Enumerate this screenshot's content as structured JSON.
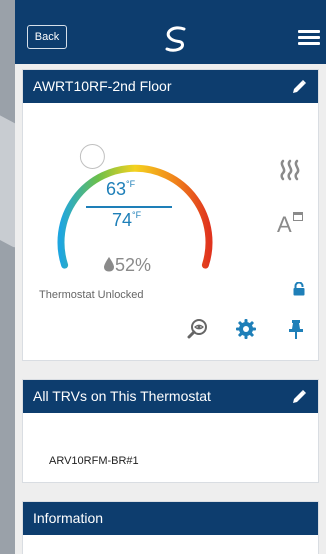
{
  "header": {
    "back_label": "Back"
  },
  "thermostat_card": {
    "title": "AWRT10RF-2nd Floor",
    "setpoint": "63",
    "setpoint_unit": "°F",
    "room_temp": "74",
    "room_unit": "°F",
    "humidity": "52%",
    "status": "Thermostat Unlocked",
    "icons": [
      "pencil-icon",
      "heat-waves-icon",
      "auto-schedule-icon",
      "lock-icon",
      "magnifier-eye-icon",
      "gear-icon",
      "pin-icon"
    ],
    "knob_fraction": 0.37,
    "colors": {
      "accent": "#1e7fb8",
      "header": "#0d3d6e"
    }
  },
  "trv_card": {
    "title": "All TRVs on This Thermostat",
    "items": [
      "ARV10RFM-BR#1"
    ]
  },
  "info_card": {
    "title": "Information"
  }
}
